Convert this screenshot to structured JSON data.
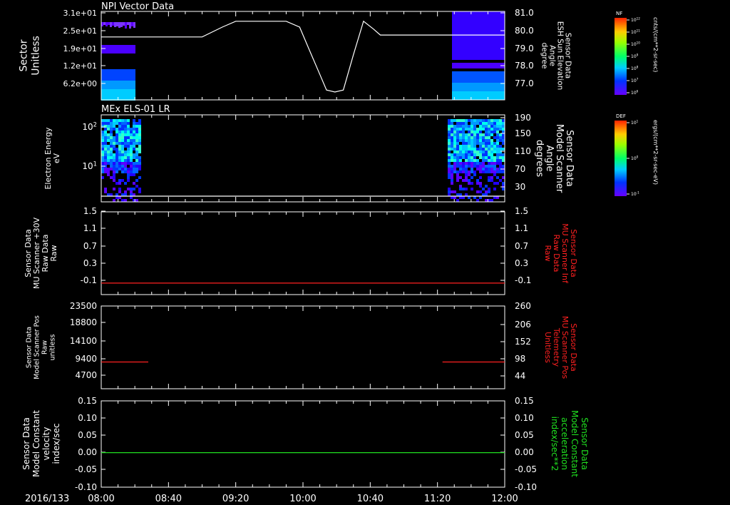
{
  "time_axis": {
    "date_label": "2016/133",
    "start_minutes": 480,
    "end_minutes": 720,
    "ticks": [
      {
        "label": "08:00",
        "t": 480
      },
      {
        "label": "08:40",
        "t": 520
      },
      {
        "label": "09:20",
        "t": 560
      },
      {
        "label": "10:00",
        "t": 600
      },
      {
        "label": "10:40",
        "t": 640
      },
      {
        "label": "11:20",
        "t": 680
      },
      {
        "label": "12:00",
        "t": 720
      }
    ]
  },
  "panels": [
    {
      "id": "npi",
      "title": "NPI Vector Data",
      "left_label": [
        "Sector",
        "Unitless"
      ],
      "left_ticks": [
        {
          "label": "3.1e+01",
          "v": 31
        },
        {
          "label": "2.5e+01",
          "v": 25
        },
        {
          "label": "1.9e+01",
          "v": 19
        },
        {
          "label": "1.2e+01",
          "v": 12
        },
        {
          "label": "6.2e+00",
          "v": 6.2
        }
      ],
      "right_label": [
        "Sensor Data",
        "ESH Sun Elevation",
        "Angle",
        "degree"
      ],
      "right_ticks": [
        {
          "label": "81.0",
          "v": 81
        },
        {
          "label": "80.0",
          "v": 80
        },
        {
          "label": "79.0",
          "v": 79
        },
        {
          "label": "78.0",
          "v": 78
        },
        {
          "label": "77.0",
          "v": 77
        }
      ],
      "colorbar": {
        "label": "NF",
        "unit": "cnts/(cm**2-sr-sec)",
        "ticks": [
          "10^12",
          "10^11",
          "10^10",
          "10^9",
          "10^8",
          "10^7",
          "10^6"
        ]
      }
    },
    {
      "id": "els",
      "title": "MEx ELS-01 LR",
      "left_label": [
        "Electron Energy",
        "eV"
      ],
      "left_ticks": [
        {
          "label": "10^2",
          "v": 100
        },
        {
          "label": "10^1",
          "v": 10
        }
      ],
      "right_label": [
        "Sensor Data",
        "Model Scanner",
        "Angle",
        "degrees"
      ],
      "right_ticks": [
        {
          "label": "190",
          "v": 190
        },
        {
          "label": "150",
          "v": 150
        },
        {
          "label": "110",
          "v": 110
        },
        {
          "label": "70",
          "v": 70
        },
        {
          "label": "30",
          "v": 30
        }
      ],
      "colorbar": {
        "label": "DEF",
        "unit": "ergs/(cm**2-sr-sec-eV)",
        "ticks": [
          "10^1",
          "10^0",
          "10^-1"
        ]
      }
    },
    {
      "id": "mu_raw",
      "title": "",
      "left_label": [
        "Sensor Data",
        "MU Scanner +30V",
        "Raw Data",
        "Raw"
      ],
      "left_ticks": [
        {
          "label": "1.5",
          "v": 1.5
        },
        {
          "label": "1.1",
          "v": 1.1
        },
        {
          "label": "0.7",
          "v": 0.7
        },
        {
          "label": "0.3",
          "v": 0.3
        },
        {
          "label": "-0.1",
          "v": -0.1
        }
      ],
      "right_label": [
        "Sensor Data",
        "MU Scanner Inf",
        "Raw Data",
        "Raw"
      ],
      "right_ticks": [
        {
          "label": "1.5",
          "v": 1.5
        },
        {
          "label": "1.1",
          "v": 1.1
        },
        {
          "label": "0.7",
          "v": 0.7
        },
        {
          "label": "0.3",
          "v": 0.3
        },
        {
          "label": "-0.1",
          "v": -0.1
        }
      ]
    },
    {
      "id": "scan_pos",
      "title": "",
      "left_label": [
        "Sensor Data",
        "Model Scanner Pos",
        "Raw",
        "unitless"
      ],
      "left_ticks": [
        {
          "label": "23500",
          "v": 23500
        },
        {
          "label": "18800",
          "v": 18800
        },
        {
          "label": "14100",
          "v": 14100
        },
        {
          "label": "9400",
          "v": 9400
        },
        {
          "label": "4700",
          "v": 4700
        }
      ],
      "right_label": [
        "Sensor Data",
        "MU Scanner Pos",
        "Telemetry",
        "Unitless"
      ],
      "right_ticks": [
        {
          "label": "260",
          "v": 260
        },
        {
          "label": "206",
          "v": 206
        },
        {
          "label": "152",
          "v": 152
        },
        {
          "label": "98",
          "v": 98
        },
        {
          "label": "44",
          "v": 44
        }
      ]
    },
    {
      "id": "velocity",
      "title": "",
      "left_label": [
        "Sensor Data",
        "Model Constant",
        "velocity",
        "index/sec"
      ],
      "left_ticks": [
        {
          "label": "0.15",
          "v": 0.15
        },
        {
          "label": "0.10",
          "v": 0.1
        },
        {
          "label": "0.05",
          "v": 0.05
        },
        {
          "label": "0.00",
          "v": 0.0
        },
        {
          "label": "-0.05",
          "v": -0.05
        },
        {
          "label": "-0.10",
          "v": -0.1
        }
      ],
      "right_label": [
        "Sensor Data",
        "Model Constant",
        "acceleration",
        "index/sec**2"
      ],
      "right_ticks": [
        {
          "label": "0.15",
          "v": 0.15
        },
        {
          "label": "0.10",
          "v": 0.1
        },
        {
          "label": "0.05",
          "v": 0.05
        },
        {
          "label": "0.00",
          "v": 0.0
        },
        {
          "label": "-0.05",
          "v": -0.05
        },
        {
          "label": "-0.10",
          "v": -0.1
        }
      ]
    }
  ],
  "colors": {
    "background": "#000000",
    "axis": "#ffffff",
    "red_series": "#ff2020",
    "green_series": "#20e020",
    "red_label": "#ff2020",
    "green_label": "#20e020"
  },
  "chart_data": [
    {
      "type": "line",
      "panel": "npi",
      "series": [
        {
          "name": "ESH Sun Elevation Angle",
          "x": [
            480,
            540,
            552,
            560,
            580,
            590,
            598,
            604,
            610,
            614,
            619,
            624,
            630,
            636,
            642,
            646,
            652,
            680,
            720
          ],
          "y": [
            79.7,
            79.7,
            80.2,
            80.5,
            80.5,
            80.5,
            80.2,
            79.0,
            77.8,
            77.0,
            76.9,
            77.0,
            78.8,
            80.5,
            80.1,
            79.8,
            79.8,
            79.8,
            79.8
          ]
        }
      ],
      "ylim": [
        76.5,
        81.0
      ]
    },
    {
      "type": "line",
      "panel": "mu_raw",
      "series": [
        {
          "name": "MU Scanner Inf",
          "x": [
            480,
            720
          ],
          "y": [
            -0.05,
            -0.05
          ]
        }
      ],
      "ylim": [
        -0.3,
        1.5
      ]
    },
    {
      "type": "line",
      "panel": "scan_pos",
      "series": [
        {
          "name": "MU Scanner Pos segment 1",
          "x": [
            480,
            508
          ],
          "y": [
            7600,
            7600
          ]
        },
        {
          "name": "MU Scanner Pos segment 2",
          "x": [
            683,
            720
          ],
          "y": [
            7600,
            7600
          ]
        }
      ],
      "ylim": [
        0,
        23500
      ]
    },
    {
      "type": "line",
      "panel": "velocity",
      "series": [
        {
          "name": "Model Constant velocity",
          "x": [
            480,
            720
          ],
          "y": [
            0.0,
            0.0
          ]
        }
      ],
      "ylim": [
        -0.1,
        0.15
      ]
    }
  ]
}
